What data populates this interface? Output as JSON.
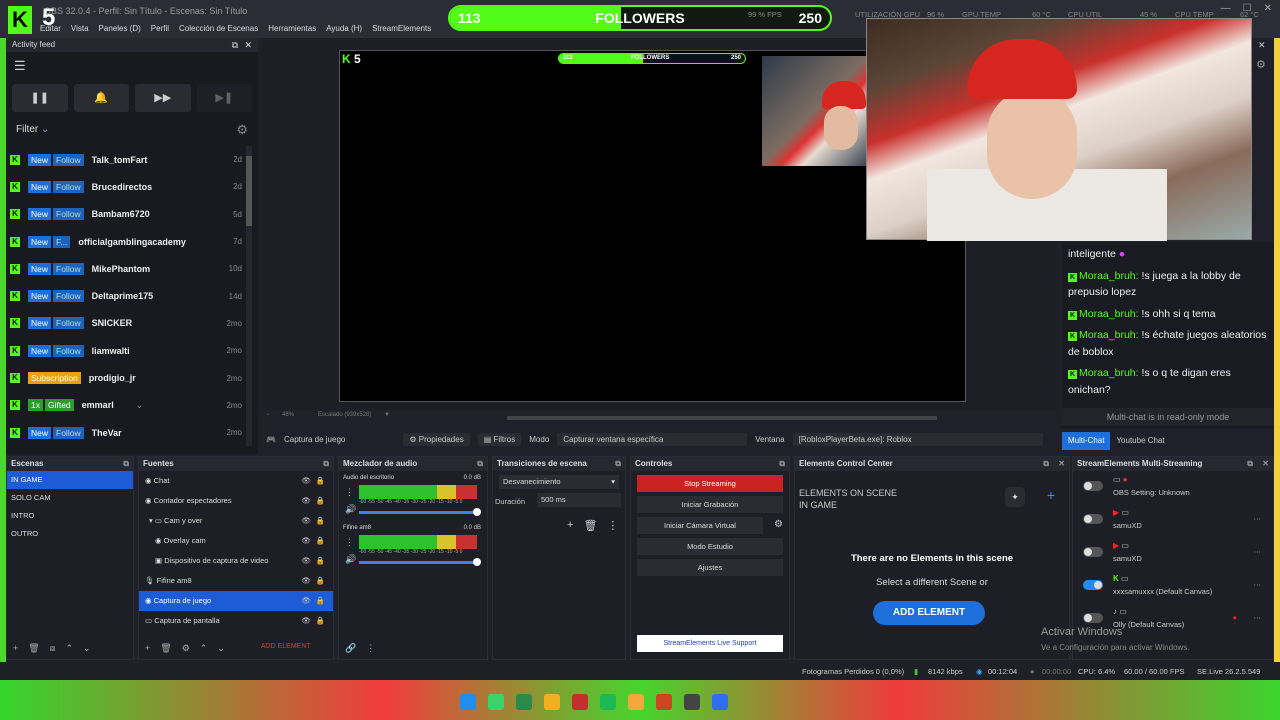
{
  "window": {
    "title": "OBS 32.0.4 - Perfil: Sin Título - Escenas: Sin Título",
    "menu": [
      "Editar",
      "Vista",
      "Paneles (D)",
      "Perfil",
      "Colección de Escenas",
      "Herramientas",
      "Ayuda (H)",
      "StreamElements"
    ]
  },
  "overlay": {
    "kick_count": "5",
    "followers_current": "113",
    "followers_label": "FOLLOWERS",
    "followers_goal": "250",
    "followers_progress": 0.45
  },
  "stats": {
    "fps": "99 % FPS",
    "gpu_use_label": "UTILIZACIÓN GPU",
    "gpu_use": "96 %",
    "gpu_temp_label": "GPU TEMP",
    "gpu_temp": "60 °C",
    "cpu_label": "CPU UTIL",
    "cpu": "45 %",
    "cpu_temp_label": "CPU TEMP",
    "cpu_temp": "62 °C"
  },
  "activity_feed": {
    "title": "Activity feed",
    "filter_label": "Filter",
    "controls": [
      "❚❚",
      "🔔",
      "▶▶",
      "▶❚"
    ],
    "events": [
      {
        "badge1": "New",
        "badge2": "Follow",
        "user": "Talk_tomFart",
        "time": "2d"
      },
      {
        "badge1": "New",
        "badge2": "Follow",
        "user": "Brucedirectos",
        "time": "2d"
      },
      {
        "badge1": "New",
        "badge2": "Follow",
        "user": "Bambam6720",
        "time": "5d"
      },
      {
        "badge1": "New",
        "badge2": "F...",
        "user": "officialgamblingacademy",
        "time": "7d"
      },
      {
        "badge1": "New",
        "badge2": "Follow",
        "user": "MikePhantom",
        "time": "10d"
      },
      {
        "badge1": "New",
        "badge2": "Follow",
        "user": "Deltaprime175",
        "time": "14d"
      },
      {
        "badge1": "New",
        "badge2": "Follow",
        "user": "SNICKER",
        "time": "2mo"
      },
      {
        "badge1": "New",
        "badge2": "Follow",
        "user": "liamwalti",
        "time": "2mo"
      },
      {
        "badge1": "Subscription",
        "badge2": "",
        "user": "prodigio_jr",
        "time": "2mo"
      },
      {
        "badge1": "1x",
        "badge2": "Gifted",
        "user": "emmarl",
        "time": "2mo"
      },
      {
        "badge1": "New",
        "badge2": "Follow",
        "user": "TheVar",
        "time": "2mo"
      }
    ]
  },
  "chat": {
    "messages": [
      {
        "user": "",
        "text": "inteligente"
      },
      {
        "user": "Moraa_bruh:",
        "text": " !s juega a la lobby de prepusio lopez"
      },
      {
        "user": "Moraa_bruh:",
        "text": " !s ohh si q tema"
      },
      {
        "user": "Moraa_bruh:",
        "text": " !s échate juegos aleatorios de boblox"
      },
      {
        "user": "Moraa_bruh:",
        "text": " !s o q te digan eres onichan?"
      }
    ],
    "readonly": "Multi-chat is in read-only mode",
    "tabs": [
      "Multi-Chat",
      "Youtube Chat"
    ]
  },
  "preview": {
    "zoom": "48%",
    "scale": "Escalado (939x528)"
  },
  "source_bar": {
    "source": "Captura de juego",
    "properties": "Propiedades",
    "filters": "Filtros",
    "mode_label": "Modo",
    "mode_value": "Capturar ventana específica",
    "window_label": "Ventana",
    "window_value": "[RobloxPlayerBeta.exe]: Roblox"
  },
  "scenes": {
    "title": "Escenas",
    "items": [
      "IN GAME",
      "SOLO CAM",
      "INTRO",
      "OUTRO"
    ]
  },
  "sources": {
    "title": "Fuentes",
    "items": [
      "Chat",
      "Contador espectadores",
      "Cam y over",
      "Overlay cam",
      "Dispositivo de captura de video",
      "Fifine am8",
      "Captura de juego",
      "Captura de pantalla"
    ],
    "add_element": "ADD ELEMENT"
  },
  "mixer": {
    "title": "Mezclador de audio",
    "channels": [
      {
        "name": "Audio del escritorio",
        "db": "0.0 dB"
      },
      {
        "name": "Fifine am8",
        "db": "0.0 dB"
      }
    ],
    "scale": "-60 -55 -50 -45 -40 -35 -30 -25 -20 -15 -10 -5 0"
  },
  "transitions": {
    "title": "Transiciones de escena",
    "type": "Desvanecimiento",
    "duration_label": "Duración",
    "duration": "500 ms"
  },
  "controls": {
    "title": "Controles",
    "buttons": [
      "Stop Streaming",
      "Iniciar Grabación",
      "Iniciar Cámara Virtual",
      "Modo Estudio",
      "Ajustes"
    ],
    "support": "StreamElements Live Support"
  },
  "ecc": {
    "title": "Elements Control Center",
    "sub1": "ELEMENTS ON SCENE",
    "sub2": "IN GAME",
    "none": "There are no Elements in this scene",
    "select": "Select a different Scene or",
    "add": "ADD ELEMENT"
  },
  "multistream": {
    "title": "StreamElements Multi-Streaming",
    "rows": [
      {
        "name": "OBS Setting: Unknown",
        "on": false
      },
      {
        "name": "samuXD",
        "on": false
      },
      {
        "name": "samuXD",
        "on": false
      },
      {
        "name": "xxxsamuxxx (Default Canvas)",
        "on": true
      },
      {
        "name": "Olly (Default Canvas)",
        "on": false
      }
    ]
  },
  "activate": {
    "line1": "Activar Windows",
    "line2": "Ve a Configuración para activar Windows."
  },
  "status": {
    "dropped": "Fotogramas Perdidos 0 (0,0%)",
    "kbps": "8142 kbps",
    "time": "00:12:04",
    "rec": "00:00:00",
    "cpu": "CPU: 6.4%",
    "fps": "60.00 / 60.00 FPS",
    "version": "SE.Live 26.2.5.549"
  }
}
